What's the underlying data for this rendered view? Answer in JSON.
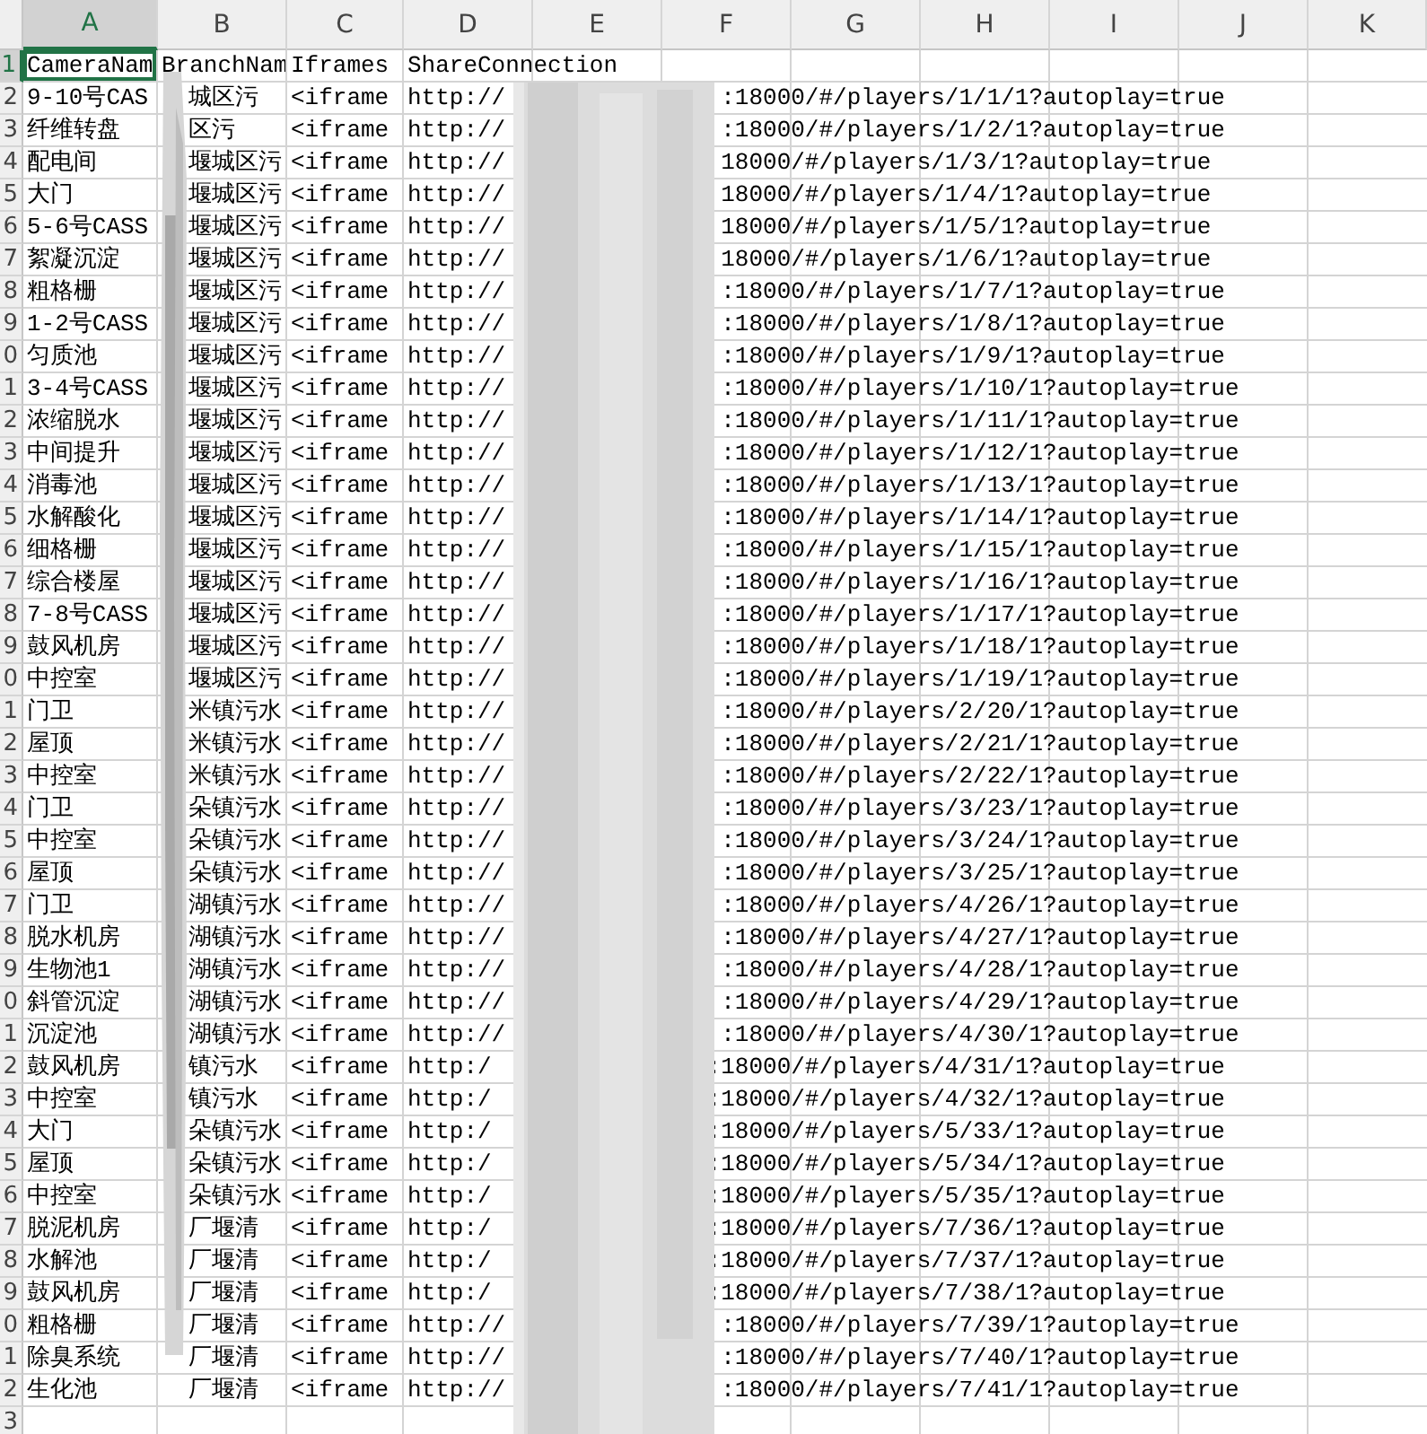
{
  "columns": [
    {
      "label": "A",
      "selected": true
    },
    {
      "label": "B",
      "selected": false
    },
    {
      "label": "C",
      "selected": false
    },
    {
      "label": "D",
      "selected": false
    },
    {
      "label": "E",
      "selected": false
    },
    {
      "label": "F",
      "selected": false
    },
    {
      "label": "G",
      "selected": false
    },
    {
      "label": "H",
      "selected": false
    },
    {
      "label": "I",
      "selected": false
    },
    {
      "label": "J",
      "selected": false
    },
    {
      "label": "K",
      "selected": false
    }
  ],
  "header_row": {
    "number": "1",
    "selected": true,
    "cells": [
      {
        "text": "CameraNam",
        "selected": true
      },
      {
        "text": "BranchNam",
        "selected": false
      },
      {
        "text": "Iframes",
        "selected": false
      },
      {
        "text": "ShareConnection",
        "selected": false
      }
    ]
  },
  "rows": [
    {
      "number": "2",
      "selected": false,
      "camera": "9-10号CAS",
      "branch": "城区污",
      "iframe": "<iframe",
      "url_start": "http://",
      "url_end": ":18000/#/players/1/1/1?autoplay=true"
    },
    {
      "number": "3",
      "selected": false,
      "camera": "纤维转盘",
      "branch": "区污",
      "iframe": "<iframe",
      "url_start": "http://",
      "url_end": ":18000/#/players/1/2/1?autoplay=true"
    },
    {
      "number": "4",
      "selected": false,
      "camera": "配电间",
      "branch": "堰城区污",
      "iframe": "<iframe",
      "url_start": "http://",
      "url_end": "18000/#/players/1/3/1?autoplay=true"
    },
    {
      "number": "5",
      "selected": false,
      "camera": "大门",
      "branch": "堰城区污",
      "iframe": "<iframe",
      "url_start": "http://",
      "url_end": "18000/#/players/1/4/1?autoplay=true"
    },
    {
      "number": "6",
      "selected": false,
      "camera": "5-6号CASS",
      "branch": "堰城区污",
      "iframe": "<iframe",
      "url_start": "http://",
      "url_end": "18000/#/players/1/5/1?autoplay=true"
    },
    {
      "number": "7",
      "selected": false,
      "camera": "絮凝沉淀",
      "branch": "堰城区污",
      "iframe": "<iframe",
      "url_start": "http://",
      "url_end": "18000/#/players/1/6/1?autoplay=true"
    },
    {
      "number": "8",
      "selected": false,
      "camera": "粗格栅",
      "branch": "堰城区污",
      "iframe": "<iframe",
      "url_start": "http://",
      "url_end": ":18000/#/players/1/7/1?autoplay=true"
    },
    {
      "number": "9",
      "selected": false,
      "camera": "1-2号CASS",
      "branch": "堰城区污",
      "iframe": "<iframe",
      "url_start": "http://",
      "url_end": ":18000/#/players/1/8/1?autoplay=true"
    },
    {
      "number": "0",
      "selected": false,
      "camera": "匀质池",
      "branch": "堰城区污",
      "iframe": "<iframe",
      "url_start": "http://",
      "url_end": ":18000/#/players/1/9/1?autoplay=true"
    },
    {
      "number": "1",
      "selected": false,
      "camera": "3-4号CASS",
      "branch": "堰城区污",
      "iframe": "<iframe",
      "url_start": "http://",
      "url_end": ":18000/#/players/1/10/1?autoplay=true"
    },
    {
      "number": "2",
      "selected": false,
      "camera": "浓缩脱水",
      "branch": "堰城区污",
      "iframe": "<iframe",
      "url_start": "http://",
      "url_end": ":18000/#/players/1/11/1?autoplay=true"
    },
    {
      "number": "3",
      "selected": false,
      "camera": "中间提升",
      "branch": "堰城区污",
      "iframe": "<iframe",
      "url_start": "http://",
      "url_end": ":18000/#/players/1/12/1?autoplay=true"
    },
    {
      "number": "4",
      "selected": false,
      "camera": "消毒池",
      "branch": "堰城区污",
      "iframe": "<iframe",
      "url_start": "http://",
      "url_end": ":18000/#/players/1/13/1?autoplay=true"
    },
    {
      "number": "5",
      "selected": false,
      "camera": "水解酸化",
      "branch": "堰城区污",
      "iframe": "<iframe",
      "url_start": "http://",
      "url_end": ":18000/#/players/1/14/1?autoplay=true"
    },
    {
      "number": "6",
      "selected": false,
      "camera": "细格栅",
      "branch": "堰城区污",
      "iframe": "<iframe",
      "url_start": "http://",
      "url_end": ":18000/#/players/1/15/1?autoplay=true"
    },
    {
      "number": "7",
      "selected": false,
      "camera": "综合楼屋",
      "branch": "堰城区污",
      "iframe": "<iframe",
      "url_start": "http://",
      "url_end": ":18000/#/players/1/16/1?autoplay=true"
    },
    {
      "number": "8",
      "selected": false,
      "camera": "7-8号CASS",
      "branch": "堰城区污",
      "iframe": "<iframe",
      "url_start": "http://",
      "url_end": ":18000/#/players/1/17/1?autoplay=true"
    },
    {
      "number": "9",
      "selected": false,
      "camera": "鼓风机房",
      "branch": "堰城区污",
      "iframe": "<iframe",
      "url_start": "http://",
      "url_end": ":18000/#/players/1/18/1?autoplay=true"
    },
    {
      "number": "0",
      "selected": false,
      "camera": "中控室",
      "branch": "堰城区污",
      "iframe": "<iframe",
      "url_start": "http://",
      "url_end": ":18000/#/players/1/19/1?autoplay=true"
    },
    {
      "number": "1",
      "selected": false,
      "camera": "门卫",
      "branch": "米镇污水",
      "iframe": "<iframe",
      "url_start": "http://",
      "url_end": ":18000/#/players/2/20/1?autoplay=true"
    },
    {
      "number": "2",
      "selected": false,
      "camera": "屋顶",
      "branch": "米镇污水",
      "iframe": "<iframe",
      "url_start": "http://",
      "url_end": ":18000/#/players/2/21/1?autoplay=true"
    },
    {
      "number": "3",
      "selected": false,
      "camera": "中控室",
      "branch": "米镇污水",
      "iframe": "<iframe",
      "url_start": "http://",
      "url_end": ":18000/#/players/2/22/1?autoplay=true"
    },
    {
      "number": "4",
      "selected": false,
      "camera": "门卫",
      "branch": "朵镇污水",
      "iframe": "<iframe",
      "url_start": "http://",
      "url_end": ":18000/#/players/3/23/1?autoplay=true"
    },
    {
      "number": "5",
      "selected": false,
      "camera": "中控室",
      "branch": "朵镇污水",
      "iframe": "<iframe",
      "url_start": "http://",
      "url_end": ":18000/#/players/3/24/1?autoplay=true"
    },
    {
      "number": "6",
      "selected": false,
      "camera": "屋顶",
      "branch": "朵镇污水",
      "iframe": "<iframe",
      "url_start": "http://",
      "url_end": ":18000/#/players/3/25/1?autoplay=true"
    },
    {
      "number": "7",
      "selected": false,
      "camera": "门卫",
      "branch": "湖镇污水",
      "iframe": "<iframe",
      "url_start": "http://",
      "url_end": ":18000/#/players/4/26/1?autoplay=true"
    },
    {
      "number": "8",
      "selected": false,
      "camera": "脱水机房",
      "branch": "湖镇污水",
      "iframe": "<iframe",
      "url_start": "http://",
      "url_end": ":18000/#/players/4/27/1?autoplay=true"
    },
    {
      "number": "9",
      "selected": false,
      "camera": "生物池1",
      "branch": "湖镇污水",
      "iframe": "<iframe",
      "url_start": "http://",
      "url_end": ":18000/#/players/4/28/1?autoplay=true"
    },
    {
      "number": "0",
      "selected": false,
      "camera": "斜管沉淀",
      "branch": "湖镇污水",
      "iframe": "<iframe",
      "url_start": "http://",
      "url_end": ":18000/#/players/4/29/1?autoplay=true"
    },
    {
      "number": "1",
      "selected": false,
      "camera": "沉淀池",
      "branch": "湖镇污水",
      "iframe": "<iframe",
      "url_start": "http://",
      "url_end": ":18000/#/players/4/30/1?autoplay=true"
    },
    {
      "number": "2",
      "selected": false,
      "camera": "鼓风机房",
      "branch": "镇污水",
      "iframe": "<iframe",
      "url_start": "http:/",
      "url_end": ":18000/#/players/4/31/1?autoplay=true"
    },
    {
      "number": "3",
      "selected": false,
      "camera": "中控室",
      "branch": "镇污水",
      "iframe": "<iframe",
      "url_start": "http:/",
      "url_end": ":18000/#/players/4/32/1?autoplay=true"
    },
    {
      "number": "4",
      "selected": false,
      "camera": "大门",
      "branch": "朵镇污水",
      "iframe": "<iframe",
      "url_start": "http:/",
      "url_end": ":18000/#/players/5/33/1?autoplay=true"
    },
    {
      "number": "5",
      "selected": false,
      "camera": "屋顶",
      "branch": "朵镇污水",
      "iframe": "<iframe",
      "url_start": "http:/",
      "url_end": ":18000/#/players/5/34/1?autoplay=true"
    },
    {
      "number": "6",
      "selected": false,
      "camera": "中控室",
      "branch": "朵镇污水",
      "iframe": "<iframe",
      "url_start": "http:/",
      "url_end": ":18000/#/players/5/35/1?autoplay=true"
    },
    {
      "number": "7",
      "selected": false,
      "camera": "脱泥机房",
      "branch": "厂堰清",
      "iframe": "<iframe",
      "url_start": "http:/",
      "url_end": ":18000/#/players/7/36/1?autoplay=true"
    },
    {
      "number": "8",
      "selected": false,
      "camera": "水解池",
      "branch": "厂堰清",
      "iframe": "<iframe",
      "url_start": "http:/",
      "url_end": ":18000/#/players/7/37/1?autoplay=true"
    },
    {
      "number": "9",
      "selected": false,
      "camera": "鼓风机房",
      "branch": "厂堰清",
      "iframe": "<iframe",
      "url_start": "http:/",
      "url_end": ":18000/#/players/7/38/1?autoplay=true"
    },
    {
      "number": "0",
      "selected": false,
      "camera": "粗格栅",
      "branch": "厂堰清",
      "iframe": "<iframe",
      "url_start": "http://",
      "url_end": ":18000/#/players/7/39/1?autoplay=true"
    },
    {
      "number": "1",
      "selected": false,
      "camera": "除臭系统",
      "branch": "厂堰清",
      "iframe": "<iframe",
      "url_start": "http://",
      "url_end": ":18000/#/players/7/40/1?autoplay=true"
    },
    {
      "number": "2",
      "selected": false,
      "camera": "生化池",
      "branch": "厂堰清",
      "iframe": "<iframe",
      "url_start": "http://",
      "url_end": ":18000/#/players/7/41/1?autoplay=true"
    },
    {
      "number": "3",
      "selected": false
    }
  ]
}
